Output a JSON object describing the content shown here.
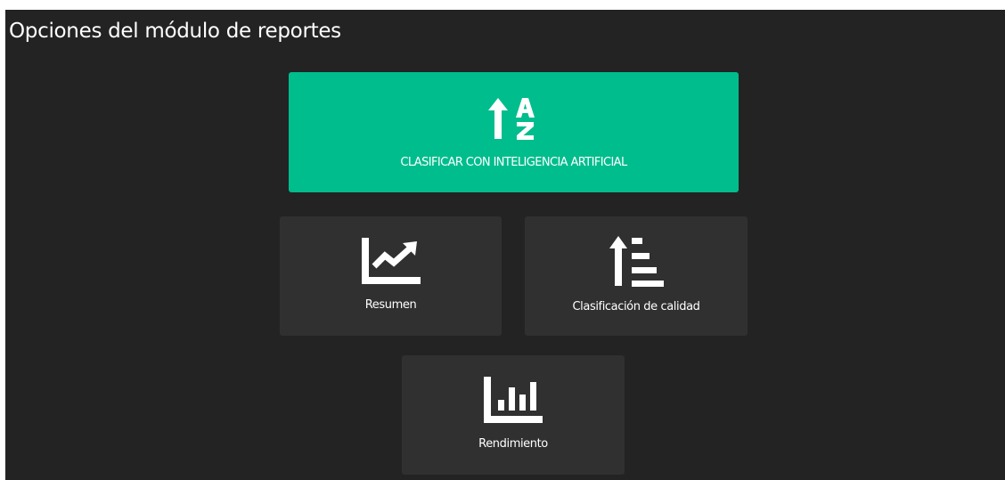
{
  "page": {
    "title": "Opciones del módulo de reportes"
  },
  "tiles": {
    "ai": {
      "label": "CLASIFICAR CON INTELIGENCIA ARTIFICIAL",
      "icon": "sort-alpha-up-icon",
      "color": "#00bd8d"
    },
    "resumen": {
      "label": "Resumen",
      "icon": "line-chart-icon"
    },
    "calidad": {
      "label": "Clasificación de calidad",
      "icon": "sort-amount-up-icon"
    },
    "rendimiento": {
      "label": "Rendimiento",
      "icon": "bar-chart-icon"
    }
  },
  "colors": {
    "background": "#232323",
    "tile": "#303030",
    "accent": "#00bd8d",
    "text": "#ffffff"
  }
}
